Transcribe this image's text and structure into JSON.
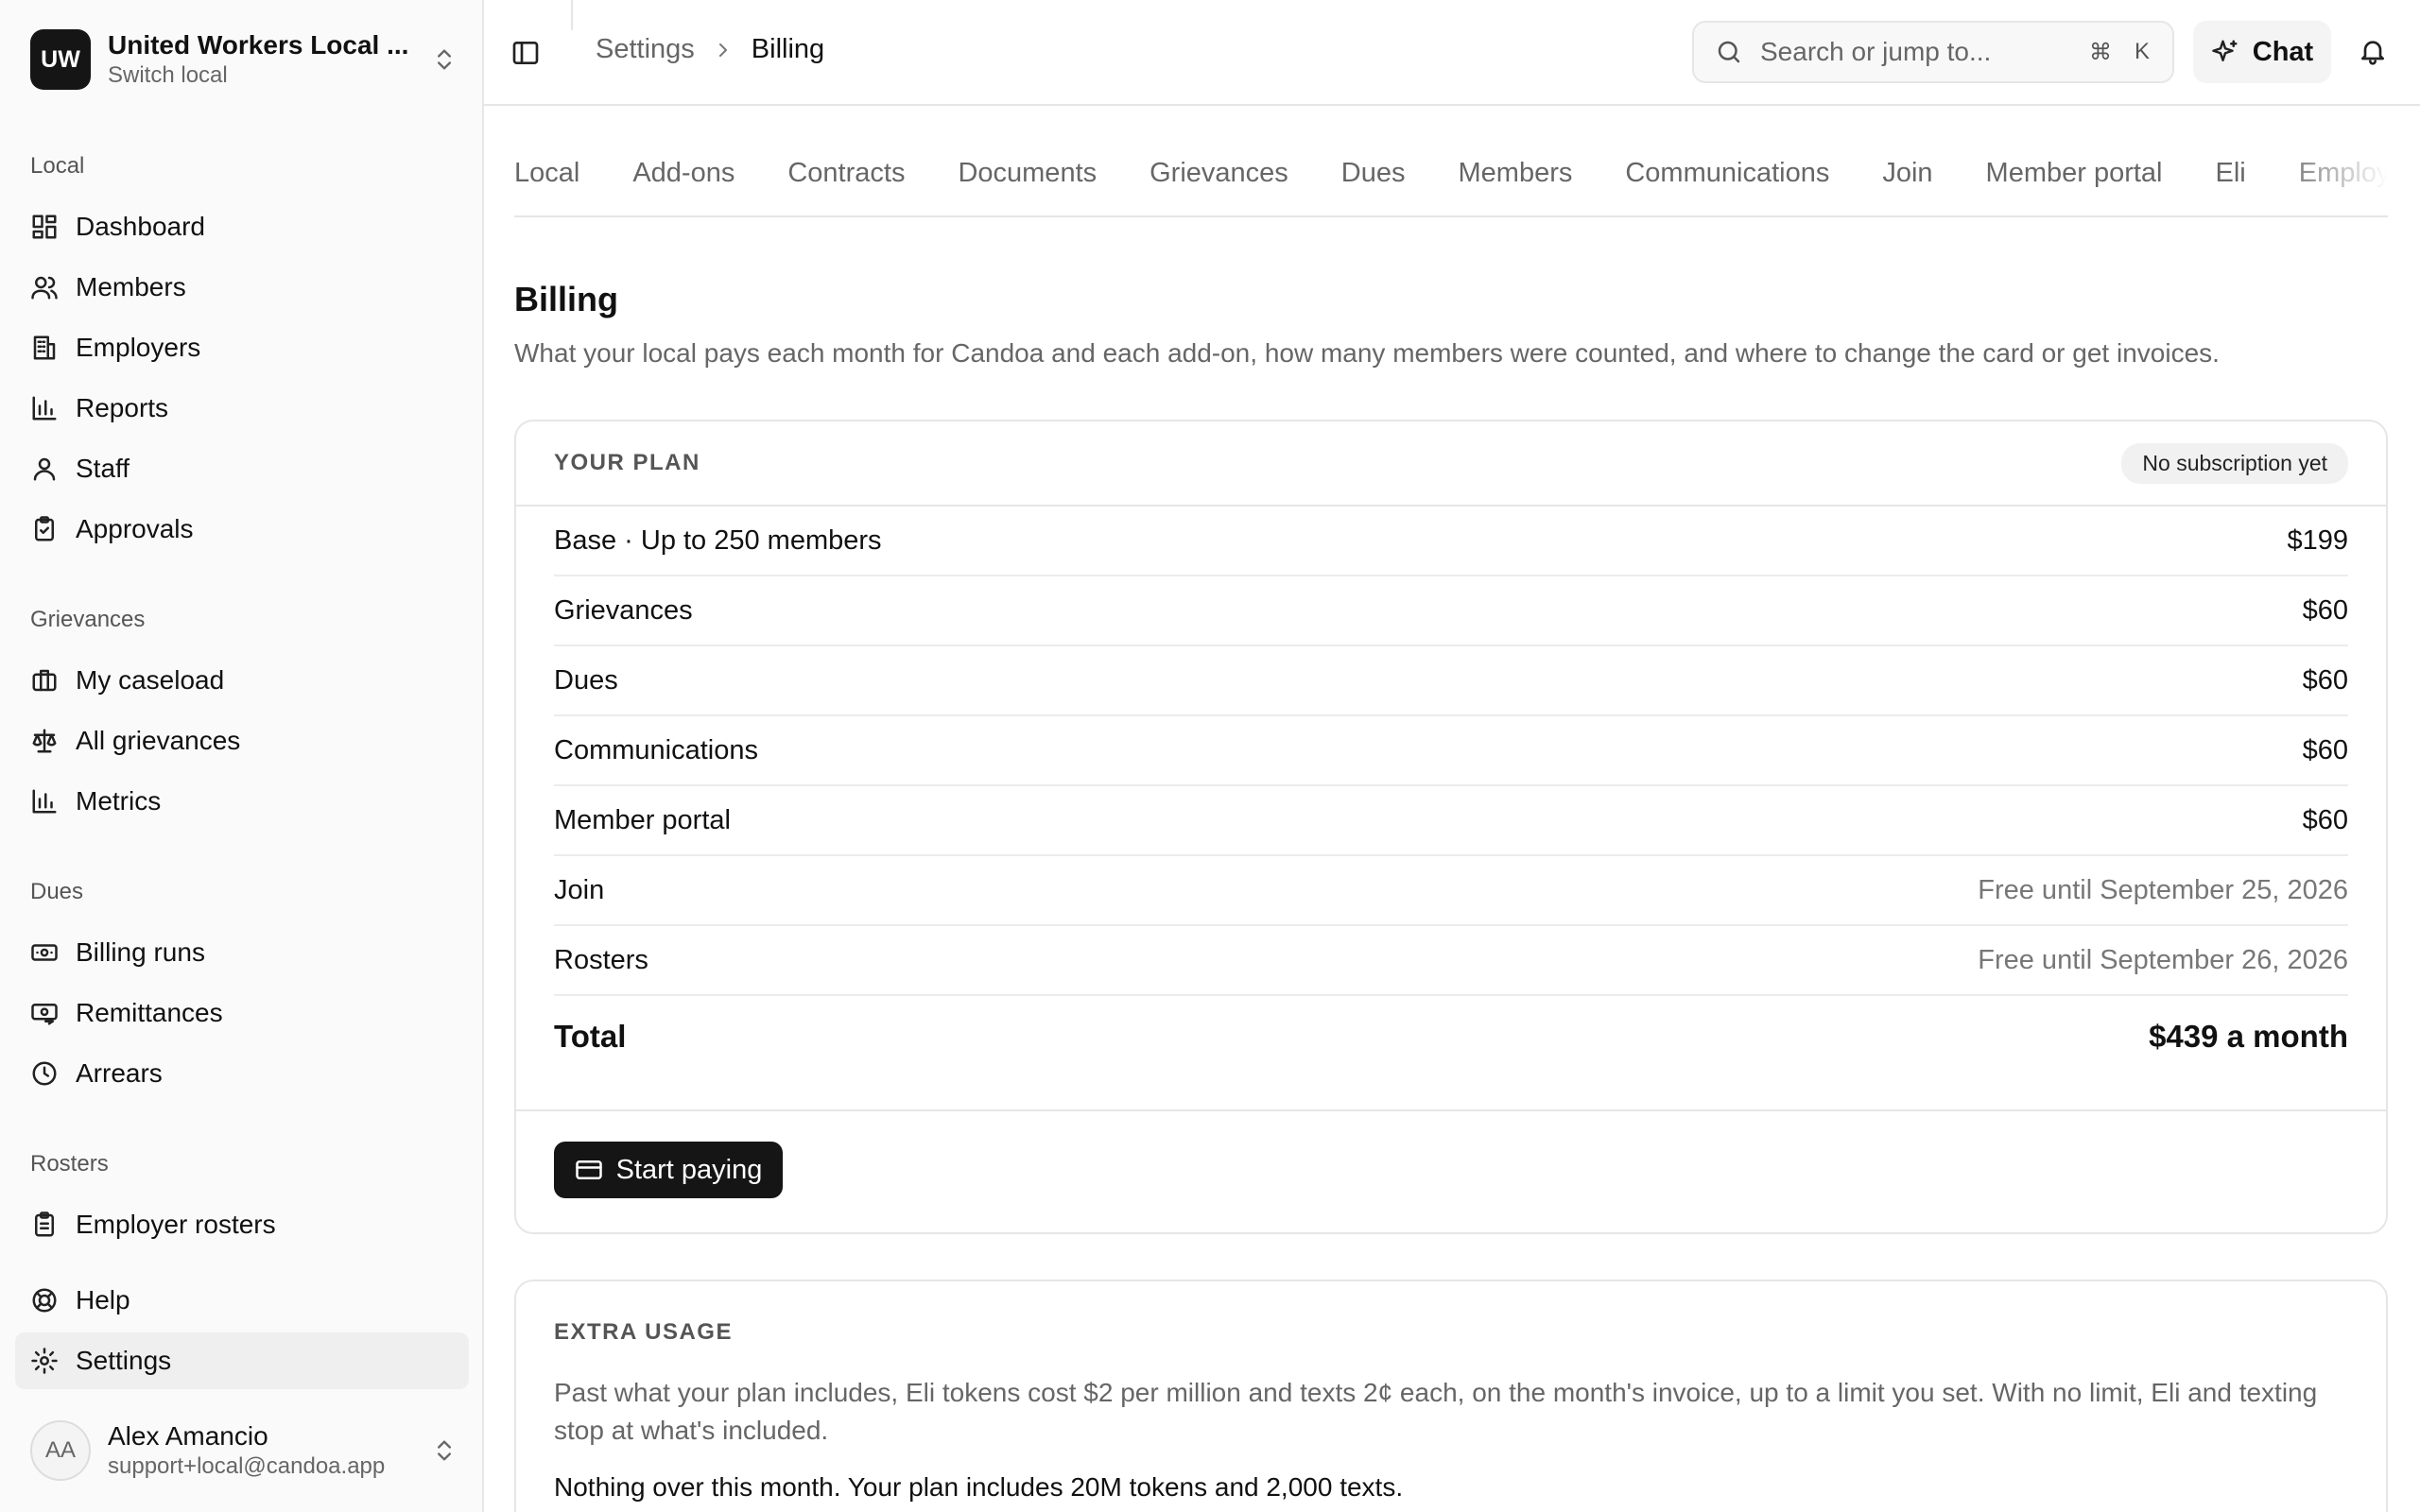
{
  "org": {
    "initials": "UW",
    "name": "United Workers Local ...",
    "sub": "Switch local"
  },
  "sidebar": {
    "sections": {
      "local": "Local",
      "grievances": "Grievances",
      "dues": "Dues",
      "rosters": "Rosters"
    },
    "items": {
      "dashboard": "Dashboard",
      "members": "Members",
      "employers": "Employers",
      "reports": "Reports",
      "staff": "Staff",
      "approvals": "Approvals",
      "my_caseload": "My caseload",
      "all_grievances": "All grievances",
      "metrics": "Metrics",
      "billing_runs": "Billing runs",
      "remittances": "Remittances",
      "arrears": "Arrears",
      "employer_rosters": "Employer rosters",
      "help": "Help",
      "settings": "Settings"
    },
    "user": {
      "initials": "AA",
      "name": "Alex Amancio",
      "email": "support+local@candoa.app"
    }
  },
  "header": {
    "breadcrumb": {
      "parent": "Settings",
      "current": "Billing"
    },
    "search": {
      "placeholder": "Search or jump to...",
      "shortcut_mod": "⌘",
      "shortcut_key": "K"
    },
    "chat_label": "Chat"
  },
  "tabs": [
    "Local",
    "Add-ons",
    "Contracts",
    "Documents",
    "Grievances",
    "Dues",
    "Members",
    "Communications",
    "Join",
    "Member portal",
    "Eli",
    "Employers"
  ],
  "page": {
    "title": "Billing",
    "description": "What your local pays each month for Candoa and each add-on, how many members were counted, and where to change the card or get invoices."
  },
  "plan": {
    "label": "YOUR PLAN",
    "status": "No subscription yet",
    "rows": [
      {
        "name": "Base · Up to 250 members",
        "price": "$199"
      },
      {
        "name": "Grievances",
        "price": "$60"
      },
      {
        "name": "Dues",
        "price": "$60"
      },
      {
        "name": "Communications",
        "price": "$60"
      },
      {
        "name": "Member portal",
        "price": "$60"
      },
      {
        "name": "Join",
        "price": "Free until September 25, 2026"
      },
      {
        "name": "Rosters",
        "price": "Free until September 26, 2026"
      }
    ],
    "total_label": "Total",
    "total_value": "$439 a month",
    "cta": "Start paying"
  },
  "extra_usage": {
    "label": "EXTRA USAGE",
    "description": "Past what your plan includes, Eli tokens cost $2 per million and texts 2¢ each, on the month's invoice, up to a limit you set. With no limit, Eli and texting stop at what's included.",
    "note": "Nothing over this month. Your plan includes 20M tokens and 2,000 texts."
  }
}
